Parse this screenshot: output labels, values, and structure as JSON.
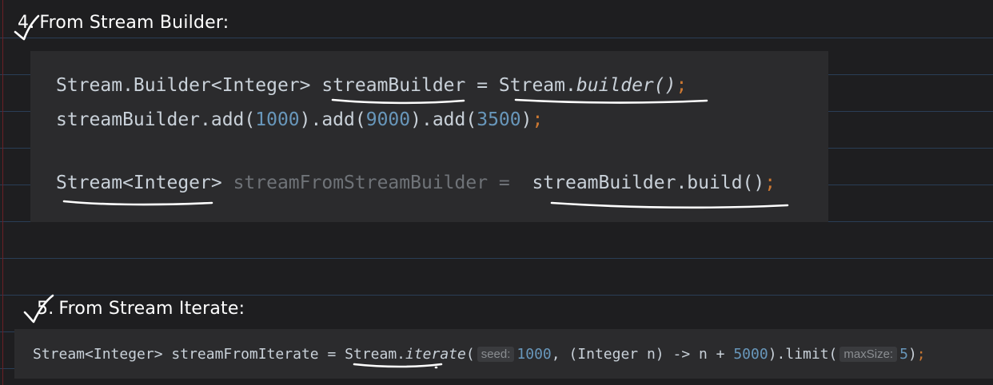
{
  "section4": {
    "number": "4.",
    "title": "From Stream Builder:",
    "code": {
      "line1": {
        "decl": "Stream.Builder<Integer> ",
        "var": "streamBuilder",
        "eq": " = ",
        "cls": "Stream.",
        "method": "builder()",
        "semi": ";"
      },
      "line2": {
        "pre": "streamBuilder.add(",
        "n1": "1000",
        "mid1": ").add(",
        "n2": "9000",
        "mid2": ").add(",
        "n3": "3500",
        "close": ")",
        "semi": ";"
      },
      "line3": {
        "type": "Stream<Integer>",
        "var": " streamFromStreamBuilder = ",
        "call": " streamBuilder.build()",
        "semi": ";"
      }
    }
  },
  "section5": {
    "number": "5.",
    "title": "From Stream Iterate:",
    "code": {
      "pre": "Stream<Integer> streamFromIterate = ",
      "cls": "Stream.",
      "method": "iterate",
      "open": "(",
      "hint_seed": "seed:",
      "n1": "1000",
      "mid": ", (Integer n) -> n + ",
      "n2": "5000",
      "mid2": ").limit(",
      "hint_max": "maxSize:",
      "n3": "5",
      "close": ")",
      "semi": ";"
    }
  },
  "colors": {
    "background": "#1e1e20",
    "code_bg": "#2b2b2d",
    "number": "#6897bb",
    "semicolon": "#cc7832",
    "ruled_line": "#2a3e56"
  }
}
